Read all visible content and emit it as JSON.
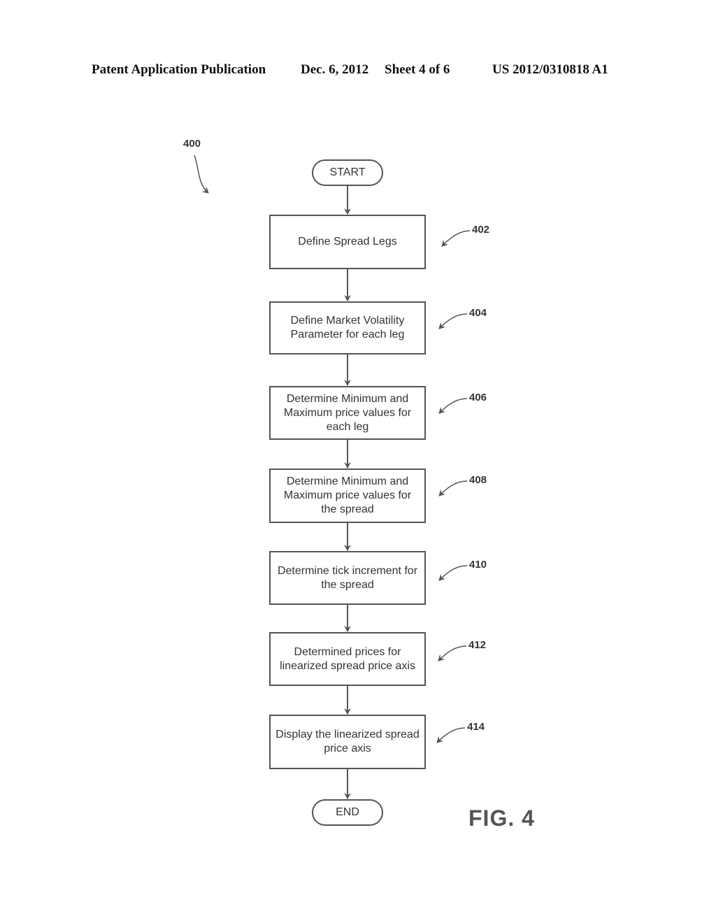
{
  "header": {
    "publication": "Patent Application Publication",
    "date": "Dec. 6, 2012",
    "sheet": "Sheet 4 of 6",
    "number": "US 2012/0310818 A1"
  },
  "diagram": {
    "ref": "400",
    "start": "START",
    "end": "END",
    "steps": [
      {
        "ref": "402",
        "text": "Define Spread Legs"
      },
      {
        "ref": "404",
        "text": "Define Market Volatility\nParameter for each leg"
      },
      {
        "ref": "406",
        "text": "Determine Minimum and\nMaximum price values for\neach leg"
      },
      {
        "ref": "408",
        "text": "Determine Minimum and\nMaximum price values for\nthe spread"
      },
      {
        "ref": "410",
        "text": "Determine tick increment for\nthe spread"
      },
      {
        "ref": "412",
        "text": "Determined prices for\nlinearized spread price axis"
      },
      {
        "ref": "414",
        "text": "Display the linearized spread\nprice axis"
      }
    ],
    "figure_label": "FIG. 4"
  }
}
